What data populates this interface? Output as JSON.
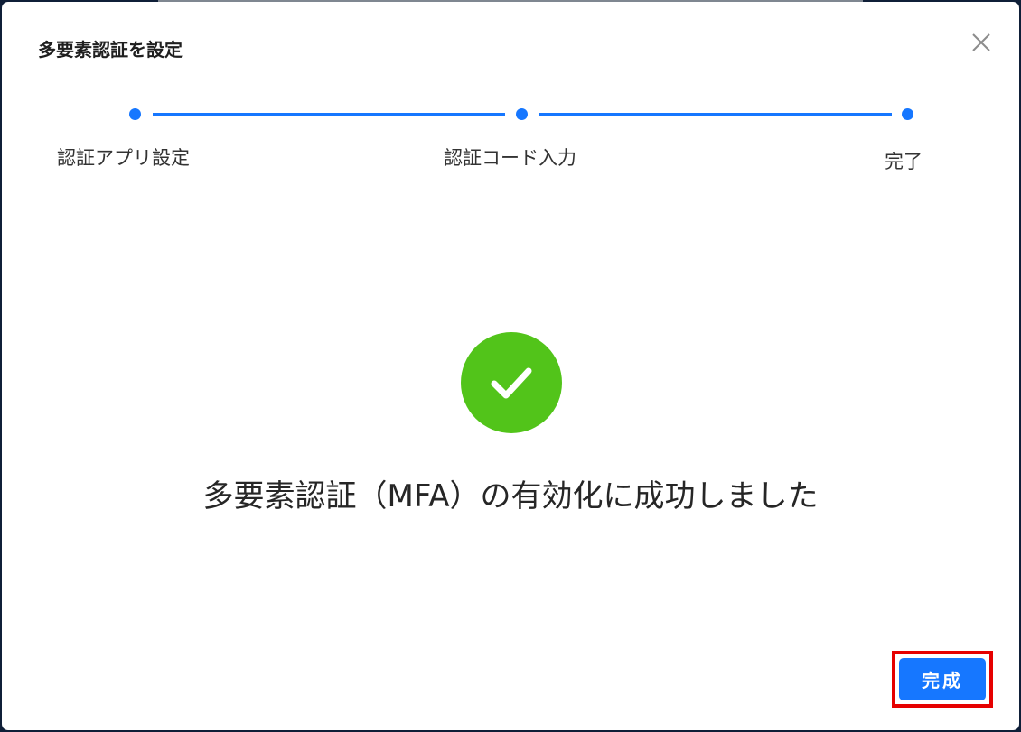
{
  "modal": {
    "title": "多要素認証を設定",
    "close_icon": "close-icon"
  },
  "steps": [
    {
      "label": "認証アプリ設定",
      "status": "done"
    },
    {
      "label": "認証コード入力",
      "status": "done"
    },
    {
      "label": "完了",
      "status": "current"
    }
  ],
  "result": {
    "icon": "check-circle-icon",
    "message": "多要素認証（MFA）の有効化に成功しました"
  },
  "footer": {
    "done_label": "完成"
  },
  "colors": {
    "primary": "#1677ff",
    "success": "#52c41a",
    "highlight": "#e60000"
  }
}
